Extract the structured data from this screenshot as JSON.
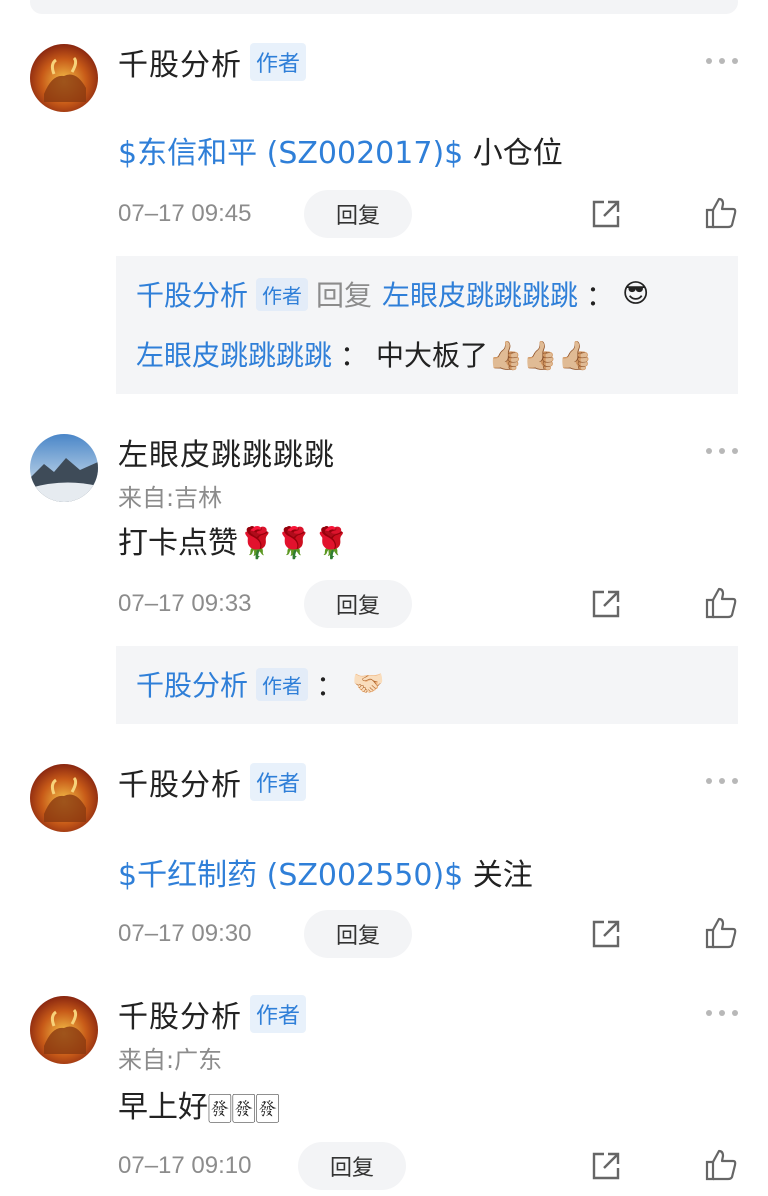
{
  "comments": [
    {
      "name": "千股分析",
      "author_tag": "作者",
      "stock_link": "$东信和平 (SZ002017)$",
      "text": " 小仓位",
      "time": "07–17 09:45",
      "reply_label": "回复",
      "replies": [
        {
          "from": "千股分析",
          "from_tag": "作者",
          "reply_word": "回复",
          "to": "左眼皮跳跳跳跳",
          "sep": "：",
          "text": "😎"
        },
        {
          "from": "左眼皮跳跳跳跳",
          "sep": "：",
          "text": "中大板了👍🏼👍🏼👍🏼"
        }
      ]
    },
    {
      "name": "左眼皮跳跳跳跳",
      "origin": "来自:吉林",
      "text": "打卡点赞🌹🌹🌹",
      "time": "07–17 09:33",
      "reply_label": "回复",
      "replies": [
        {
          "from": "千股分析",
          "from_tag": "作者",
          "sep": "：",
          "text": "🤝🏻"
        }
      ]
    },
    {
      "name": "千股分析",
      "author_tag": "作者",
      "stock_link": "$千红制药 (SZ002550)$",
      "text": " 关注",
      "time": "07–17 09:30",
      "reply_label": "回复"
    },
    {
      "name": "千股分析",
      "author_tag": "作者",
      "origin": "来自:广东",
      "text": "早上好🀅🀅🀅",
      "time": "07–17 09:10",
      "reply_label": "回复"
    }
  ],
  "icons": {
    "more": "more-dots-icon",
    "share": "share-icon",
    "like": "thumbs-up-icon"
  },
  "colors": {
    "link": "#2f7fd8",
    "tag_bg": "#e8f1fb",
    "reply_bg": "#f4f5f7"
  }
}
